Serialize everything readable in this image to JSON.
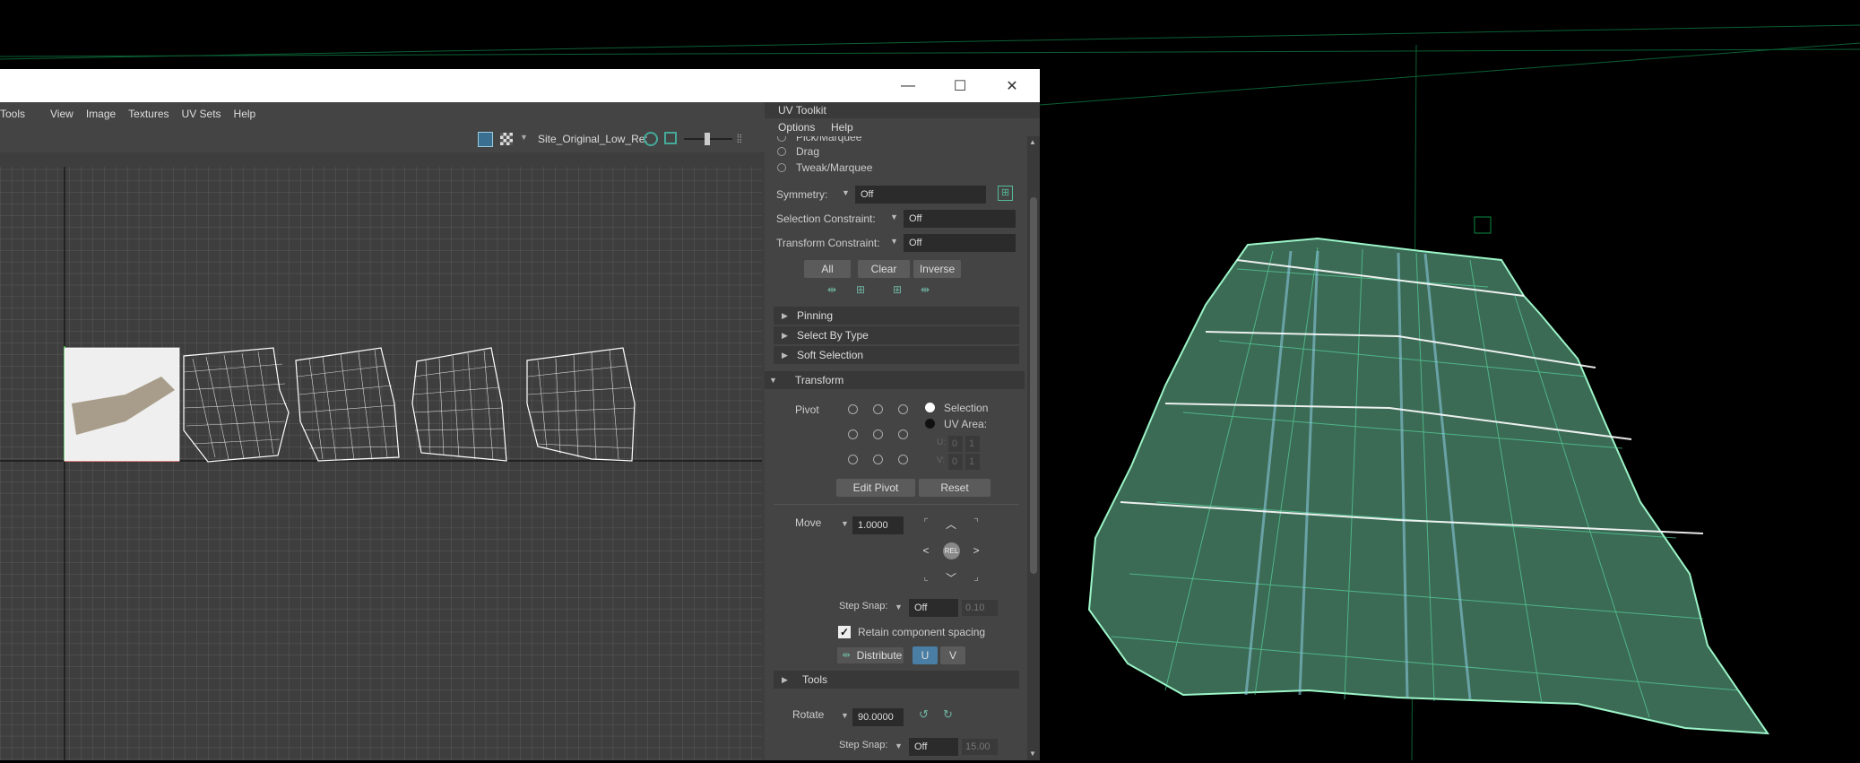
{
  "window": {
    "minimize_glyph": "—",
    "maximize_glyph": "☐",
    "close_glyph": "✕"
  },
  "uv_editor": {
    "menu": [
      "Tools",
      "View",
      "Image",
      "Textures",
      "UV Sets",
      "Help"
    ],
    "image_name": "Site_Original_Low_Re:"
  },
  "toolkit": {
    "title": "UV Toolkit",
    "menu": [
      "Options",
      "Help"
    ],
    "pick_marquee": "Pick/Marquee",
    "drag": "Drag",
    "tweak_marquee": "Tweak/Marquee",
    "symmetry_label": "Symmetry:",
    "symmetry_value": "Off",
    "selection_constraint_label": "Selection Constraint:",
    "selection_constraint_value": "Off",
    "transform_constraint_label": "Transform Constraint:",
    "transform_constraint_value": "Off",
    "all_button": "All",
    "clear_button": "Clear",
    "inverse_button": "Inverse",
    "sections": {
      "pinning": "Pinning",
      "select_by_type": "Select By Type",
      "soft_selection": "Soft Selection",
      "transform": "Transform",
      "tools": "Tools"
    },
    "pivot_label": "Pivot",
    "pivot_selection": "Selection",
    "pivot_uv_area": "UV Area:",
    "u_label": "U:",
    "v_label": "V:",
    "u_values": [
      "0",
      "1"
    ],
    "v_values": [
      "0",
      "1"
    ],
    "edit_pivot_button": "Edit Pivot",
    "reset_button": "Reset",
    "move_label": "Move",
    "move_value": "1.0000",
    "rel_label": "REL",
    "step_snap_label": "Step Snap:",
    "step_snap_value": "Off",
    "step_snap_amount": "0.10",
    "retain_spacing_label": "Retain component spacing",
    "distribute_label": "Distribute",
    "u_button": "U",
    "v_button": "V",
    "rotate_label": "Rotate",
    "rotate_value": "90.0000",
    "rotate_step_snap_value": "Off",
    "rotate_step_snap_amount": "15.00"
  }
}
